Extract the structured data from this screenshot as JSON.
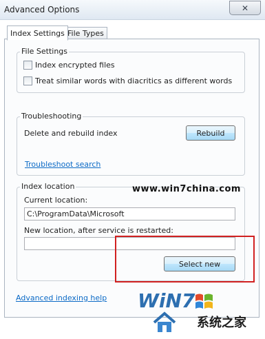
{
  "window": {
    "title": "Advanced Options",
    "close_glyph": "✕"
  },
  "tabs": [
    {
      "label": "Index Settings"
    },
    {
      "label": "File Types"
    }
  ],
  "file_settings": {
    "label": "File Settings",
    "options": [
      {
        "label": "Index encrypted files",
        "checked": false
      },
      {
        "label": "Treat similar words with diacritics as different words",
        "checked": false
      }
    ]
  },
  "troubleshooting": {
    "label": "Troubleshooting",
    "delete_rebuild_text": "Delete and rebuild index",
    "rebuild_button": "Rebuild",
    "troubleshoot_link": "Troubleshoot search"
  },
  "index_location": {
    "label": "Index location",
    "current_label": "Current location:",
    "current_value": "C:\\ProgramData\\Microsoft",
    "new_label": "New location, after service is restarted:",
    "new_value": "",
    "select_new_button": "Select new"
  },
  "footer": {
    "advanced_help_link": "Advanced indexing help"
  },
  "watermark": {
    "site": "www.win7china.com",
    "brand": "WiN7",
    "brand_cn": "系统之家"
  },
  "colors": {
    "highlight": "#d12020",
    "link": "#0b6ac6"
  }
}
